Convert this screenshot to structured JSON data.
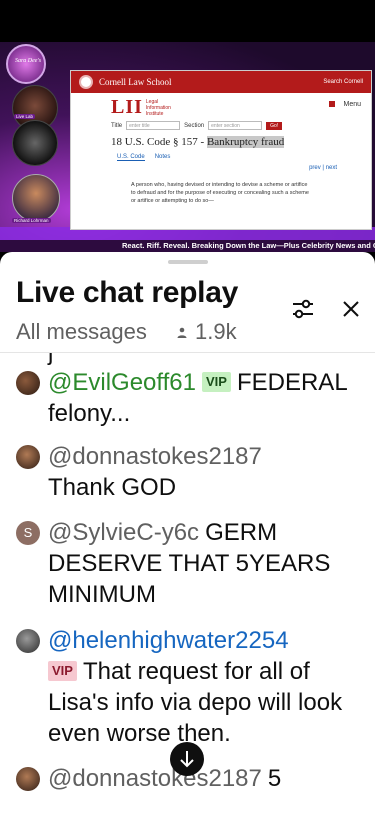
{
  "video": {
    "web_page": {
      "school_name": "Cornell Law School",
      "search_link": "Search Cornell",
      "lii_logo": "LII",
      "lii_text_1": "Legal",
      "lii_text_2": "Information",
      "lii_text_3": "Institute",
      "menu_label": "Menu",
      "title_label": "Title",
      "title_placeholder": "enter title",
      "section_label": "Section",
      "section_placeholder": "enter section",
      "go_label": "Go!",
      "code_title_prefix": "18 U.S. Code § 157 - ",
      "code_title_highlight": "Bankruptcy fraud",
      "tab_code": "U.S. Code",
      "tab_notes": "Notes",
      "prev_next": "prev | next",
      "body_text": "A person who, having devised or intending to devise a scheme or artifice to defraud and for the purpose of executing or concealing such a scheme or artifice or attempting to do so—"
    },
    "logo_text": "Sara Dee's",
    "cam_label_1": "Live Lab",
    "cam_label_2": "Richard Lohrman",
    "ticker": "React. Riff. Reveal. Breaking Down the Law—Plus Celebrity News and Cry"
  },
  "chat_panel": {
    "title": "Live chat replay",
    "filter": "All messages",
    "viewer_count": "1.9k",
    "settings_icon": "tune-icon",
    "close_icon": "close-icon",
    "partial_top_text": "j",
    "messages": [
      {
        "author": "@EvilGeoff61",
        "badge": "VIP",
        "text": "FEDERAL felony..."
      },
      {
        "author": "@donnastokes2187",
        "text": "Thank GOD"
      },
      {
        "author": "@SylvieC-y6c",
        "avatar_letter": "S",
        "text": "GERM DESERVE THAT 5YEARS MINIMUM"
      },
      {
        "author": "@helenhighwater2254",
        "badge": "VIP",
        "text": "That request for all of Lisa's info via depo will look even worse then."
      },
      {
        "author": "@donnastokes2187",
        "text": "5"
      }
    ],
    "scroll_down_icon": "arrow-down-icon"
  },
  "colors": {
    "accent_red": "#b31b1b",
    "member_green": "#2c8a2c",
    "author_blue": "#1666c0",
    "vip_pink_bg": "#f6c8d0",
    "vip_green_bg": "#c5f0c0"
  }
}
